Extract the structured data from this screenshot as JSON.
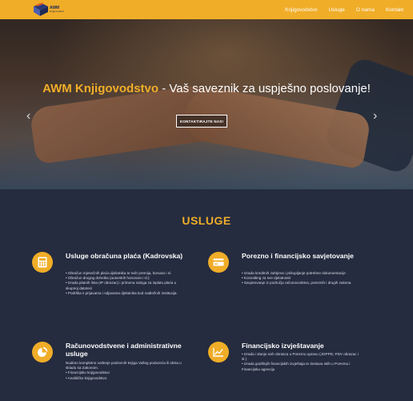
{
  "brand": {
    "logo_text": "AWM",
    "logo_sub": "knjigovodstvo"
  },
  "nav": {
    "items": [
      "Knjigovodstvo",
      "Usluge",
      "O nama",
      "Kontakt"
    ]
  },
  "hero": {
    "brand_title": "AWM Knjigovodstvo",
    "tagline": " - Vaš saveznik za uspješno poslovanje!",
    "cta": "KONTAKTIRAJTE NAS!",
    "prev": "‹",
    "next": "›"
  },
  "services": {
    "title": "USLUGE",
    "items": [
      {
        "icon": "calculator-icon",
        "title": "Usluge obračuna plaća (Kadrovska)",
        "lines": [
          "• Obračun mjesečnih plaća djelatnika te svih premija, bonusa i sl.",
          "• Obračun drugog dohotka (autorskih honorara i sl.)",
          "• Izrada platnih lista (IP obrazac) i primena naloga za isplatu plaća u skupnoj datoteci",
          "• Podrška s prijavama i odjavama djelatnika kod nadležnih institucija."
        ]
      },
      {
        "icon": "card-icon",
        "title": "Porezno i financijsko savjetovanje",
        "lines": [
          "• Izrada kreditnih zahtjeva i prikupljanje potrebne dokumentacije",
          "• Konzalting za sve djelatnosti",
          "• Savjetovanje iz područja računovodstva, poreznih i drugih zakona"
        ]
      },
      {
        "icon": "pie-chart-icon",
        "title": "Računovodstvene i administrativne usluge",
        "lines": [
          "Nudimo kompletno vođenje poslovnih knjiga Vašeg poduzeća ili obrta u skladu sa Zakonom.",
          "• Financijsko knjigovodstvo",
          "• Analitičko knjigovodstvo"
        ]
      },
      {
        "icon": "line-chart-icon",
        "title": "Financijsko izvještavanje",
        "lines": [
          "• Izrada i slanje svih obrasca u Poreznu upravu (JOPPD, PDV obrazac i sl.)",
          "• Izrada godišnjih financijskih izvještaja te dostava istih u Poreznu i Financijsku agenciju"
        ]
      }
    ]
  },
  "colors": {
    "accent": "#f0ad28",
    "dark": "#252c3f"
  }
}
